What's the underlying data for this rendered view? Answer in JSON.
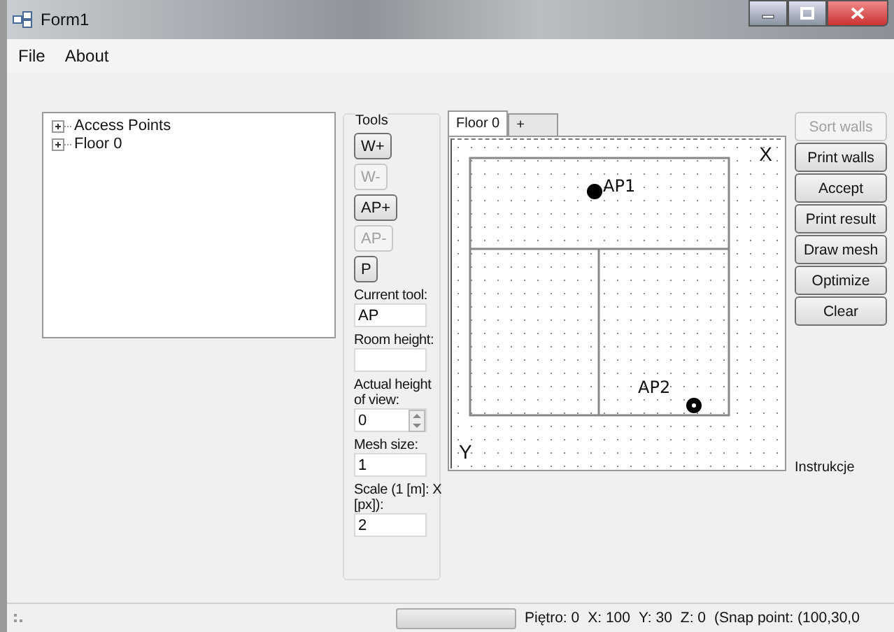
{
  "window": {
    "title": "Form1"
  },
  "menu": [
    "File",
    "About"
  ],
  "tree": {
    "items": [
      {
        "label": "Access Points",
        "expanded": false
      },
      {
        "label": "Floor 0",
        "expanded": false
      }
    ]
  },
  "tools": {
    "title": "Tools",
    "buttons": [
      {
        "label": "W+",
        "disabled": false
      },
      {
        "label": "W-",
        "disabled": true
      },
      {
        "label": "AP+",
        "disabled": false
      },
      {
        "label": "AP-",
        "disabled": true
      },
      {
        "label": "P",
        "disabled": false
      }
    ],
    "fields": [
      {
        "kind": "text",
        "label": "Current tool:",
        "value": "AP"
      },
      {
        "kind": "text",
        "label": "Room height:"
      },
      {
        "kind": "spin",
        "label": "Actual height of view:",
        "value": "0"
      },
      {
        "kind": "text",
        "label": "Mesh size:",
        "value": "1"
      },
      {
        "kind": "text",
        "label": "Scale (1 [m]: X [px]):",
        "value": "2"
      }
    ]
  },
  "tabs": [
    {
      "label": "Floor 0",
      "selected": true
    },
    {
      "label": "+",
      "selected": false
    }
  ],
  "canvas": {
    "x_axis": "X",
    "y_axis": "Y",
    "access_points": [
      {
        "label": "AP1"
      },
      {
        "label": "AP2"
      }
    ]
  },
  "actions": [
    {
      "label": "Sort walls",
      "disabled": true
    },
    {
      "label": "Print walls",
      "disabled": false
    },
    {
      "label": "Accept",
      "disabled": false
    },
    {
      "label": "Print result",
      "disabled": false
    },
    {
      "label": "Draw mesh",
      "disabled": false
    },
    {
      "label": "Optimize",
      "disabled": false
    },
    {
      "label": "Clear",
      "disabled": false
    }
  ],
  "instructions_label": "Instrukcje",
  "status_bar": {
    "progress": {
      "level": 0
    },
    "items": [
      "Piętro: 0",
      "X: 100",
      "Y: 30",
      "Z: 0",
      "(Snap point: (100,30,0"
    ]
  }
}
